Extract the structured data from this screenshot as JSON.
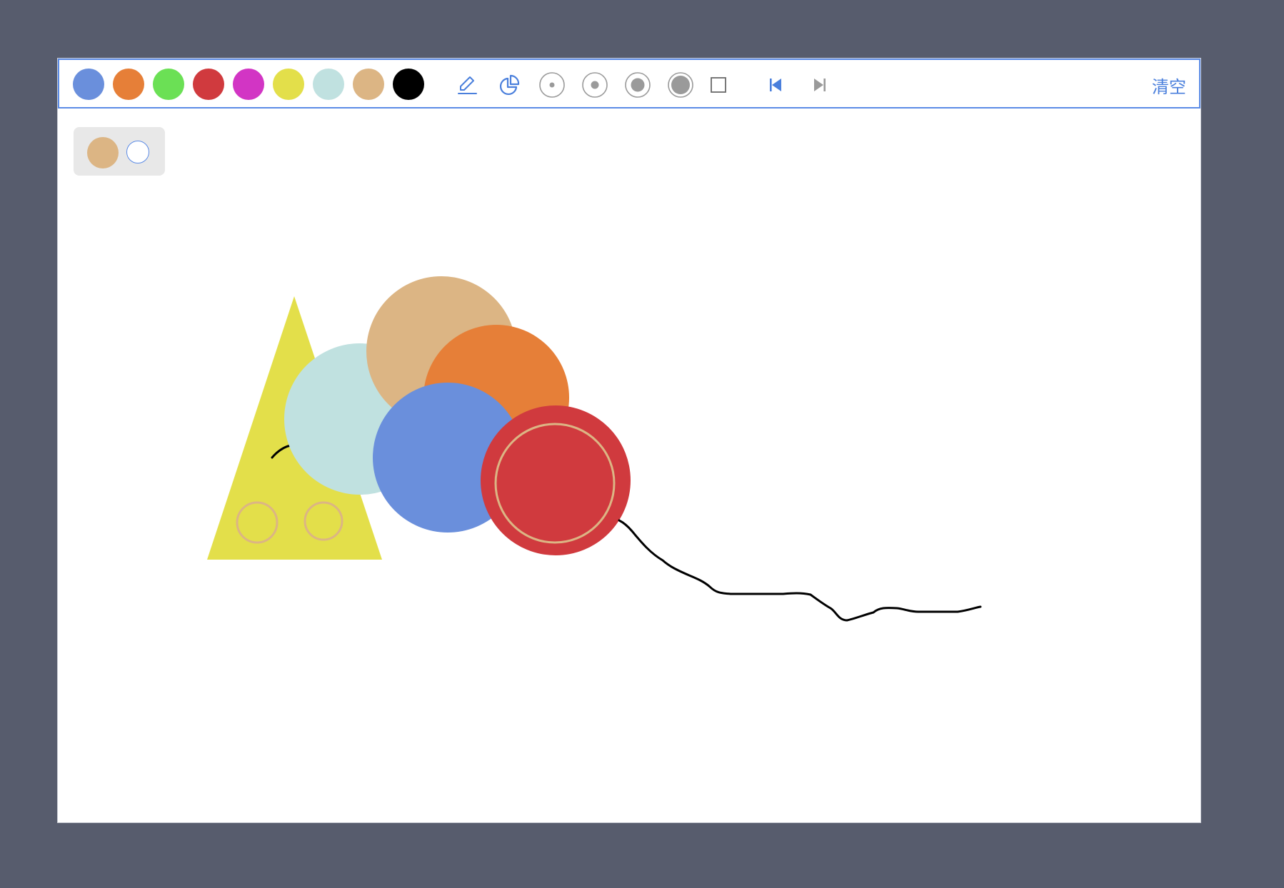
{
  "palette": [
    {
      "name": "blue",
      "color": "#6a8fdc"
    },
    {
      "name": "orange",
      "color": "#e67f38"
    },
    {
      "name": "green",
      "color": "#6be055"
    },
    {
      "name": "red",
      "color": "#d03a3e"
    },
    {
      "name": "magenta",
      "color": "#d235c4"
    },
    {
      "name": "yellow",
      "color": "#e3df4a"
    },
    {
      "name": "light-cyan",
      "color": "#c0e1e0"
    },
    {
      "name": "tan",
      "color": "#dcb584"
    },
    {
      "name": "black",
      "color": "#000000"
    }
  ],
  "tools": {
    "pencil": "pencil-icon",
    "shape": "pie-shape-icon",
    "brush_sizes": [
      "brush-size-xs-icon",
      "brush-size-s-icon",
      "brush-size-m-icon",
      "brush-size-l-icon"
    ],
    "eraser": "square-eraser-icon",
    "undo": "undo-icon",
    "redo": "redo-icon"
  },
  "colors": {
    "accent": "#4a7fdc",
    "toolbar_border": "#5b8be6",
    "background": "#575c6d",
    "disabled": "#9a9a9a"
  },
  "toolbar": {
    "clear_label": "清空"
  },
  "current": {
    "color": "#dcb584"
  }
}
